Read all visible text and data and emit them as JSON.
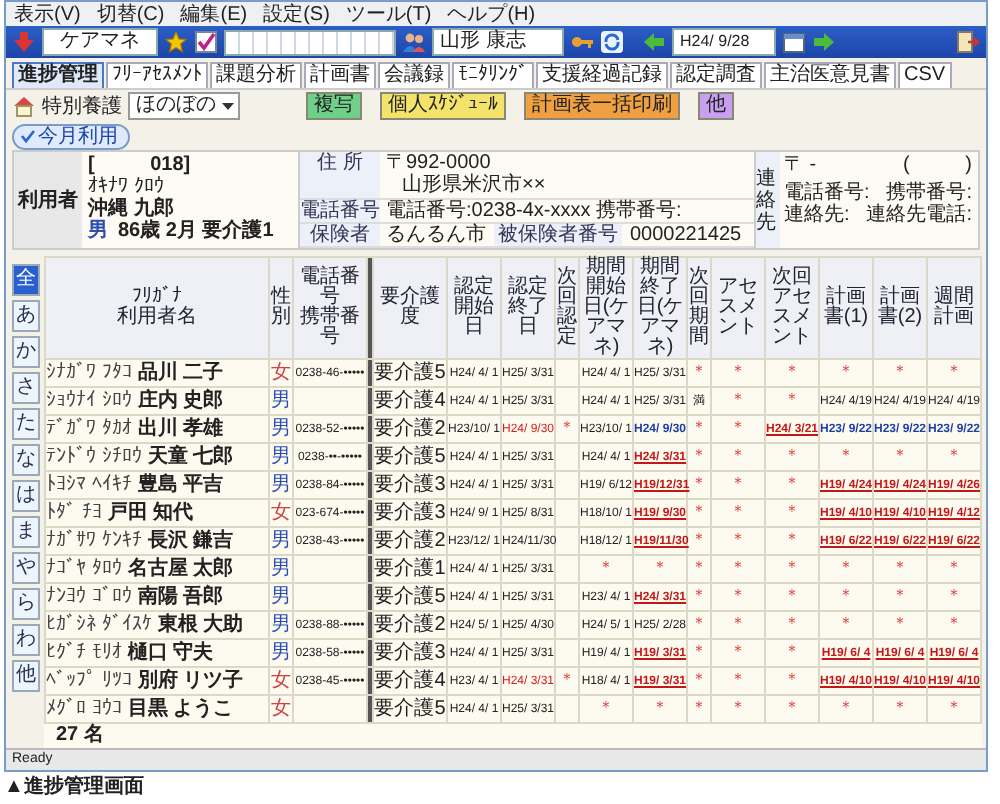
{
  "menu": [
    "表示(V)",
    "切替(C)",
    "編集(E)",
    "設定(S)",
    "ツール(T)",
    "ヘルプ(H)"
  ],
  "toolbar": {
    "office": "ケアマネ",
    "staff": "山形 康志",
    "date": "H24/ 9/28"
  },
  "tabs": [
    {
      "label": "進捗管理",
      "selected": true
    },
    {
      "label": "ﾌﾘｰｱｾｽﾒﾝﾄ",
      "selected": false
    },
    {
      "label": "課題分析",
      "selected": false
    },
    {
      "label": "計画書",
      "selected": false
    },
    {
      "label": "会議録",
      "selected": false
    },
    {
      "label": "ﾓﾆﾀﾘﾝｸﾞ",
      "selected": false
    },
    {
      "label": "支援経過記録",
      "selected": false
    },
    {
      "label": "認定調査",
      "selected": false
    },
    {
      "label": "主治医意見書",
      "selected": false
    },
    {
      "label": "CSV",
      "selected": false
    }
  ],
  "filter": {
    "facility_type": "特別養護",
    "facility": "ほのぼの",
    "buttons": [
      {
        "label": "複写",
        "color": "#6fd08a"
      },
      {
        "label": "個人ｽｹｼﾞｭｰﾙ",
        "color": "#f4e36a"
      },
      {
        "label": "計画表一括印刷",
        "color": "#f0a040"
      },
      {
        "label": "他",
        "color": "#c9a0f0"
      }
    ]
  },
  "month_filter": "今月利用",
  "user": {
    "label": "利用者",
    "id": "[          018]",
    "kana": "ｵｷﾅﾜ ｸﾛｳ",
    "name": "沖縄 九郎",
    "sex": {
      "label": "男",
      "color": "#2a4fb0"
    },
    "age_info": "86歳 2月 要介護1"
  },
  "address": {
    "label": "住 所",
    "postal": "〒992-0000",
    "line": "山形県米沢市××"
  },
  "phone": {
    "label": "電話番号",
    "value": "電話番号:0238-4x-xxxx 携帯番号:"
  },
  "insurer": {
    "label": "保険者",
    "value": "るんるん市",
    "number_label": "被保険者番号",
    "number": "0000221425"
  },
  "contact": {
    "label": "連絡先",
    "postal": "〒  -",
    "paren": "(          )",
    "phone": "電話番号:",
    "mobile": "携帯番号:",
    "person": "連絡先:",
    "person_phone": "連絡先電話:"
  },
  "index_tabs": [
    {
      "label": "全",
      "selected": true
    },
    {
      "label": "あ",
      "selected": false
    },
    {
      "label": "か",
      "selected": false
    },
    {
      "label": "さ",
      "selected": false
    },
    {
      "label": "た",
      "selected": false
    },
    {
      "label": "な",
      "selected": false
    },
    {
      "label": "は",
      "selected": false
    },
    {
      "label": "ま",
      "selected": false
    },
    {
      "label": "や",
      "selected": false
    },
    {
      "label": "ら",
      "selected": false
    },
    {
      "label": "わ",
      "selected": false
    },
    {
      "label": "他",
      "selected": false
    }
  ],
  "table": {
    "name_header": {
      "kana": "ﾌﾘｶﾞﾅ",
      "label": "利用者名"
    },
    "sex_header": "性別",
    "phone_header": {
      "top": "電話番号",
      "bottom": "携帯番号"
    },
    "columns": [
      "要介護度",
      "認定開始日",
      "認定終了日",
      "次回認定",
      "期間開始日(ケアマネ)",
      "期間終了日(ケアマネ)",
      "次回期間",
      "アセスメント",
      "次回アセスメント",
      "計画書(1)",
      "計画書(2)",
      "週間計画"
    ],
    "rows": [
      {
        "kana": "ｼﾅｶﾞﾜ ﾌﾀｺ",
        "name": "品川 二子",
        "sex": {
          "label": "女",
          "color": "#d04040"
        },
        "phone": "0238-46-•••••",
        "cells": [
          {
            "text": "要介護5",
            "kind": "plain"
          },
          {
            "text": "H24/ 4/ 1",
            "kind": "plain"
          },
          {
            "text": "H25/ 3/31",
            "kind": "plain"
          },
          null,
          {
            "text": "H24/ 4/ 1",
            "kind": "plain"
          },
          {
            "text": "H25/ 3/31",
            "kind": "plain"
          },
          {
            "text": "＊",
            "kind": "mark"
          },
          {
            "text": "＊",
            "kind": "mark"
          },
          {
            "text": "＊",
            "kind": "mark"
          },
          {
            "text": "＊",
            "kind": "mark"
          },
          {
            "text": "＊",
            "kind": "mark"
          },
          {
            "text": "＊",
            "kind": "mark"
          }
        ]
      },
      {
        "kana": "ｼｮｳﾅｲ ｼﾛｳ",
        "name": "庄内 史郎",
        "sex": {
          "label": "男",
          "color": "#2a4fb0"
        },
        "cells": [
          {
            "text": "要介護4",
            "kind": "plain"
          },
          {
            "text": "H24/ 4/ 1",
            "kind": "plain"
          },
          {
            "text": "H25/ 3/31",
            "kind": "plain"
          },
          null,
          {
            "text": "H24/ 4/ 1",
            "kind": "plain"
          },
          {
            "text": "H25/ 3/31",
            "kind": "plain"
          },
          {
            "text": "満",
            "kind": "plain"
          },
          {
            "text": "＊",
            "kind": "mark"
          },
          {
            "text": "＊",
            "kind": "mark"
          },
          {
            "text": "H24/ 4/19",
            "kind": "plain"
          },
          {
            "text": "H24/ 4/19",
            "kind": "plain"
          },
          {
            "text": "H24/ 4/19",
            "kind": "plain"
          }
        ]
      },
      {
        "kana": "ﾃﾞｶﾞﾜ ﾀｶｵ",
        "name": "出川 孝雄",
        "sex": {
          "label": "男",
          "color": "#2a4fb0"
        },
        "phone": "0238-52-•••••",
        "cells": [
          {
            "text": "要介護2",
            "kind": "plain"
          },
          {
            "text": "H23/10/ 1",
            "kind": "plain"
          },
          {
            "text": "H24/ 9/30",
            "kind": "alert"
          },
          {
            "text": "＊",
            "kind": "mark"
          },
          {
            "text": "H23/10/ 1",
            "kind": "plain"
          },
          {
            "text": "H24/ 9/30",
            "kind": "recent"
          },
          {
            "text": "＊",
            "kind": "mark"
          },
          {
            "text": "＊",
            "kind": "mark"
          },
          {
            "text": "H24/ 3/21",
            "kind": "overdue"
          },
          {
            "text": "H23/ 9/22",
            "kind": "recent"
          },
          {
            "text": "H23/ 9/22",
            "kind": "recent"
          },
          {
            "text": "H23/ 9/22",
            "kind": "recent"
          }
        ]
      },
      {
        "kana": "ﾃﾝﾄﾞｳ ｼﾁﾛｳ",
        "name": "天童 七郎",
        "sex": {
          "label": "男",
          "color": "#2a4fb0"
        },
        "phone": "0238-••-•••••",
        "cells": [
          {
            "text": "要介護5",
            "kind": "plain"
          },
          {
            "text": "H24/ 4/ 1",
            "kind": "plain"
          },
          {
            "text": "H25/ 3/31",
            "kind": "plain"
          },
          null,
          {
            "text": "H24/ 4/ 1",
            "kind": "plain"
          },
          {
            "text": "H24/ 3/31",
            "kind": "overdue"
          },
          {
            "text": "＊",
            "kind": "mark"
          },
          {
            "text": "＊",
            "kind": "mark"
          },
          {
            "text": "＊",
            "kind": "mark"
          },
          {
            "text": "＊",
            "kind": "mark"
          },
          {
            "text": "＊",
            "kind": "mark"
          },
          {
            "text": "＊",
            "kind": "mark"
          }
        ]
      },
      {
        "kana": "ﾄﾖｼﾏ ﾍｲｷﾁ",
        "name": "豊島 平吉",
        "sex": {
          "label": "男",
          "color": "#2a4fb0"
        },
        "phone": "0238-84-•••••",
        "cells": [
          {
            "text": "要介護3",
            "kind": "plain"
          },
          {
            "text": "H24/ 4/ 1",
            "kind": "plain"
          },
          {
            "text": "H25/ 3/31",
            "kind": "plain"
          },
          null,
          {
            "text": "H19/ 6/12",
            "kind": "plain"
          },
          {
            "text": "H19/12/31",
            "kind": "overdue"
          },
          {
            "text": "＊",
            "kind": "mark"
          },
          {
            "text": "＊",
            "kind": "mark"
          },
          {
            "text": "＊",
            "kind": "mark"
          },
          {
            "text": "H19/ 4/24",
            "kind": "overdue"
          },
          {
            "text": "H19/ 4/24",
            "kind": "overdue"
          },
          {
            "text": "H19/ 4/26",
            "kind": "overdue"
          }
        ]
      },
      {
        "kana": "ﾄﾀﾞ ﾁﾖ",
        "name": "戸田 知代",
        "sex": {
          "label": "女",
          "color": "#d04040"
        },
        "phone": "023-674-•••••",
        "cells": [
          {
            "text": "要介護3",
            "kind": "plain"
          },
          {
            "text": "H24/ 9/ 1",
            "kind": "plain"
          },
          {
            "text": "H25/ 8/31",
            "kind": "plain"
          },
          null,
          {
            "text": "H18/10/ 1",
            "kind": "plain"
          },
          {
            "text": "H19/ 9/30",
            "kind": "overdue"
          },
          {
            "text": "＊",
            "kind": "mark"
          },
          {
            "text": "＊",
            "kind": "mark"
          },
          {
            "text": "＊",
            "kind": "mark"
          },
          {
            "text": "H19/ 4/10",
            "kind": "overdue"
          },
          {
            "text": "H19/ 4/10",
            "kind": "overdue"
          },
          {
            "text": "H19/ 4/12",
            "kind": "overdue"
          }
        ]
      },
      {
        "kana": "ﾅｶﾞｻﾜ ｹﾝｷﾁ",
        "name": "長沢 鎌吉",
        "sex": {
          "label": "男",
          "color": "#2a4fb0"
        },
        "phone": "0238-43-•••••",
        "cells": [
          {
            "text": "要介護2",
            "kind": "plain"
          },
          {
            "text": "H23/12/ 1",
            "kind": "plain"
          },
          {
            "text": "H24/11/30",
            "kind": "plain"
          },
          null,
          {
            "text": "H18/12/ 1",
            "kind": "plain"
          },
          {
            "text": "H19/11/30",
            "kind": "overdue"
          },
          {
            "text": "＊",
            "kind": "mark"
          },
          {
            "text": "＊",
            "kind": "mark"
          },
          {
            "text": "＊",
            "kind": "mark"
          },
          {
            "text": "H19/ 6/22",
            "kind": "overdue"
          },
          {
            "text": "H19/ 6/22",
            "kind": "overdue"
          },
          {
            "text": "H19/ 6/22",
            "kind": "overdue"
          }
        ]
      },
      {
        "kana": "ﾅｺﾞﾔ ﾀﾛｳ",
        "name": "名古屋 太郎",
        "sex": {
          "label": "男",
          "color": "#2a4fb0"
        },
        "cells": [
          {
            "text": "要介護1",
            "kind": "plain"
          },
          {
            "text": "H24/ 4/ 1",
            "kind": "plain"
          },
          {
            "text": "H25/ 3/31",
            "kind": "plain"
          },
          null,
          {
            "text": "＊",
            "kind": "mark"
          },
          {
            "text": "＊",
            "kind": "mark"
          },
          {
            "text": "＊",
            "kind": "mark"
          },
          {
            "text": "＊",
            "kind": "mark"
          },
          {
            "text": "＊",
            "kind": "mark"
          },
          {
            "text": "＊",
            "kind": "mark"
          },
          {
            "text": "＊",
            "kind": "mark"
          },
          {
            "text": "＊",
            "kind": "mark"
          }
        ]
      },
      {
        "kana": "ﾅﾝﾖｳ ｺﾞﾛｳ",
        "name": "南陽 吾郎",
        "sex": {
          "label": "男",
          "color": "#2a4fb0"
        },
        "cells": [
          {
            "text": "要介護5",
            "kind": "plain"
          },
          {
            "text": "H24/ 4/ 1",
            "kind": "plain"
          },
          {
            "text": "H25/ 3/31",
            "kind": "plain"
          },
          null,
          {
            "text": "H23/ 4/ 1",
            "kind": "plain"
          },
          {
            "text": "H24/ 3/31",
            "kind": "overdue"
          },
          {
            "text": "＊",
            "kind": "mark"
          },
          {
            "text": "＊",
            "kind": "mark"
          },
          {
            "text": "＊",
            "kind": "mark"
          },
          {
            "text": "＊",
            "kind": "mark"
          },
          {
            "text": "＊",
            "kind": "mark"
          },
          {
            "text": "＊",
            "kind": "mark"
          }
        ]
      },
      {
        "kana": "ﾋｶﾞｼﾈ ﾀﾞｲｽｹ",
        "name": "東根 大助",
        "sex": {
          "label": "男",
          "color": "#2a4fb0"
        },
        "phone": "0238-88-•••••",
        "cells": [
          {
            "text": "要介護2",
            "kind": "plain"
          },
          {
            "text": "H24/ 5/ 1",
            "kind": "plain"
          },
          {
            "text": "H25/ 4/30",
            "kind": "plain"
          },
          null,
          {
            "text": "H24/ 5/ 1",
            "kind": "plain"
          },
          {
            "text": "H25/ 2/28",
            "kind": "plain"
          },
          {
            "text": "＊",
            "kind": "mark"
          },
          {
            "text": "＊",
            "kind": "mark"
          },
          {
            "text": "＊",
            "kind": "mark"
          },
          {
            "text": "＊",
            "kind": "mark"
          },
          {
            "text": "＊",
            "kind": "mark"
          },
          {
            "text": "＊",
            "kind": "mark"
          }
        ]
      },
      {
        "kana": "ﾋｸﾞﾁ ﾓﾘｵ",
        "name": "樋口 守夫",
        "sex": {
          "label": "男",
          "color": "#2a4fb0"
        },
        "phone": "0238-58-•••••",
        "cells": [
          {
            "text": "要介護3",
            "kind": "plain"
          },
          {
            "text": "H24/ 4/ 1",
            "kind": "plain"
          },
          {
            "text": "H25/ 3/31",
            "kind": "plain"
          },
          null,
          {
            "text": "H19/ 4/ 1",
            "kind": "plain"
          },
          {
            "text": "H19/ 3/31",
            "kind": "overdue"
          },
          {
            "text": "＊",
            "kind": "mark"
          },
          {
            "text": "＊",
            "kind": "mark"
          },
          {
            "text": "＊",
            "kind": "mark"
          },
          {
            "text": "H19/ 6/ 4",
            "kind": "overdue"
          },
          {
            "text": "H19/ 6/ 4",
            "kind": "overdue"
          },
          {
            "text": "H19/ 6/ 4",
            "kind": "overdue"
          }
        ]
      },
      {
        "kana": "ﾍﾞｯﾌﾟ ﾘﾂｺ",
        "name": "別府 リツ子",
        "sex": {
          "label": "女",
          "color": "#d04040"
        },
        "phone": "0238-45-•••••",
        "cells": [
          {
            "text": "要介護4",
            "kind": "plain"
          },
          {
            "text": "H23/ 4/ 1",
            "kind": "plain"
          },
          {
            "text": "H24/ 3/31",
            "kind": "alert"
          },
          {
            "text": "＊",
            "kind": "mark"
          },
          {
            "text": "H18/ 4/ 1",
            "kind": "plain"
          },
          {
            "text": "H19/ 3/31",
            "kind": "overdue"
          },
          {
            "text": "＊",
            "kind": "mark"
          },
          {
            "text": "＊",
            "kind": "mark"
          },
          {
            "text": "＊",
            "kind": "mark"
          },
          {
            "text": "H19/ 4/10",
            "kind": "overdue"
          },
          {
            "text": "H19/ 4/10",
            "kind": "overdue"
          },
          {
            "text": "H19/ 4/10",
            "kind": "overdue"
          }
        ]
      },
      {
        "kana": "ﾒｸﾞﾛ ﾖｳｺ",
        "name": "目黒 ようこ",
        "sex": {
          "label": "女",
          "color": "#d04040"
        },
        "cells": [
          {
            "text": "要介護5",
            "kind": "plain"
          },
          {
            "text": "H24/ 4/ 1",
            "kind": "plain"
          },
          {
            "text": "H25/ 3/31",
            "kind": "plain"
          },
          null,
          {
            "text": "＊",
            "kind": "mark"
          },
          {
            "text": "＊",
            "kind": "mark"
          },
          {
            "text": "＊",
            "kind": "mark"
          },
          {
            "text": "＊",
            "kind": "mark"
          },
          {
            "text": "＊",
            "kind": "mark"
          },
          {
            "text": "＊",
            "kind": "mark"
          },
          {
            "text": "＊",
            "kind": "mark"
          },
          {
            "text": "＊",
            "kind": "mark"
          }
        ]
      }
    ]
  },
  "count": "27 名",
  "status": "Ready",
  "caption": "▲進捗管理画面"
}
